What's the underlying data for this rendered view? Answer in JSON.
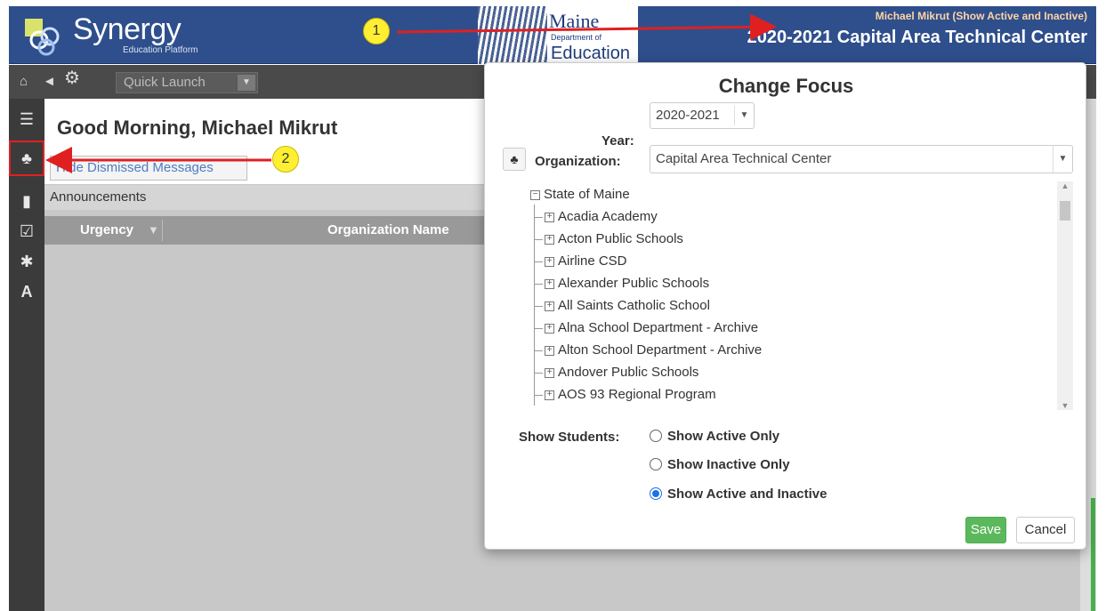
{
  "header": {
    "logo_text": "Synergy",
    "logo_sub": "Education Platform",
    "maine_title": "Maine",
    "maine_dept": "Department of",
    "maine_edu": "Education",
    "user_line": "Michael Mikrut (Show Active and Inactive)",
    "org_line": "2020-2021 Capital Area Technical Center"
  },
  "toolbar": {
    "quick_launch_placeholder": "Quick Launch",
    "icons": [
      "home-icon",
      "megaphone-icon",
      "gears-icon"
    ]
  },
  "sidebar": {
    "items": [
      "menu-icon",
      "tree-icon",
      "bookmark-icon",
      "checkbox-icon",
      "asterisk-icon",
      "road-icon"
    ]
  },
  "main": {
    "greeting": "Good Morning, Michael Mikrut",
    "hide_dismissed": "Hide Dismissed Messages",
    "announcements": "Announcements",
    "columns": [
      "Urgency",
      "Organization Name"
    ]
  },
  "dialog": {
    "title": "Change Focus",
    "year_label": "Year:",
    "year_value": "2020-2021",
    "org_label": "Organization:",
    "org_value": "Capital Area Technical Center",
    "tree_root": "State of Maine",
    "tree_items": [
      "Acadia Academy",
      "Acton Public Schools",
      "Airline CSD",
      "Alexander Public Schools",
      "All Saints Catholic School",
      "Alna School Department - Archive",
      "Alton School Department - Archive",
      "Andover Public Schools",
      "AOS 93 Regional Program"
    ],
    "show_students_label": "Show Students:",
    "radio_options": [
      "Show Active Only",
      "Show Inactive Only",
      "Show Active and Inactive"
    ],
    "selected_option": "Show Active and Inactive",
    "save": "Save",
    "cancel": "Cancel"
  },
  "annotations": {
    "badge_1": "1",
    "badge_2": "2"
  },
  "colors": {
    "header_blue": "#2e4f8c",
    "save_green": "#5cb85c",
    "annotation_red": "#e02020",
    "badge_yellow": "#ffef33"
  }
}
